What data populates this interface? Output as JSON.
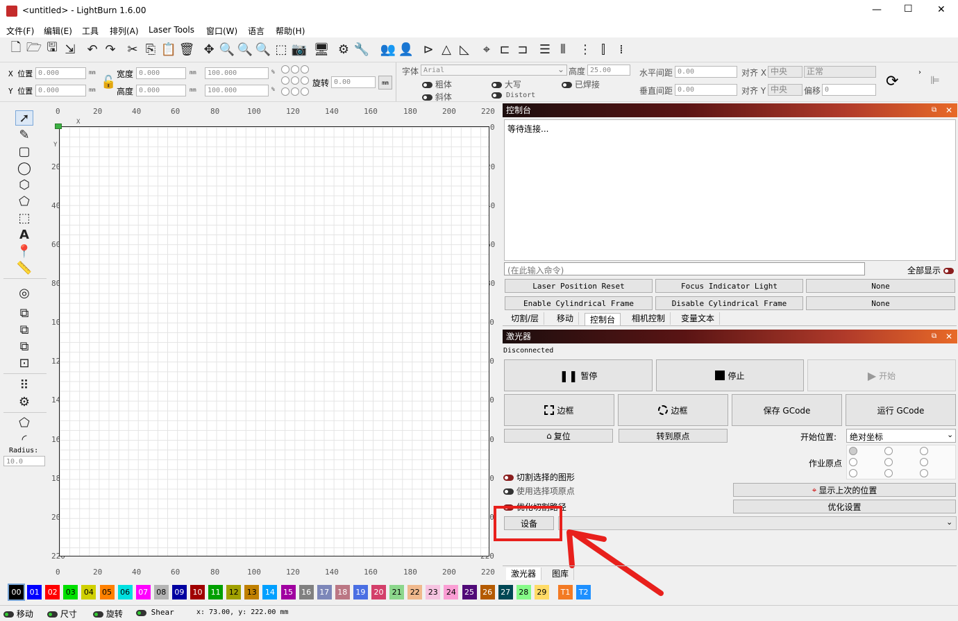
{
  "window": {
    "title": "<untitled>  - LightBurn 1.6.00",
    "min": "—",
    "max": "☐",
    "close": "✕"
  },
  "menu": [
    "文件(F)",
    "编辑(E)",
    "工具",
    "排列(A)",
    "Laser Tools",
    "窗口(W)",
    "语言",
    "帮助(H)"
  ],
  "props": {
    "x_label": "X 位置",
    "y_label": "Y 位置",
    "x_val": "0.000",
    "y_val": "0.000",
    "unit": "mm",
    "w_label": "宽度",
    "h_label": "高度",
    "w_val": "0.000",
    "h_val": "0.000",
    "pw_val": "100.000",
    "ph_val": "100.000",
    "pct": "%",
    "rot_label": "旋转",
    "rot_val": "0.00",
    "mm_btn": "mm",
    "font_label": "字体",
    "font_val": "Arial",
    "bold": "粗体",
    "italic": "斜体",
    "caps": "大写",
    "distort": "Distort",
    "welded": "已焊接",
    "height_label": "高度",
    "height_val": "25.00",
    "hspace_label": "水平间距",
    "vspace_label": "垂直间距",
    "hspace_val": "0.00",
    "vspace_val": "0.00",
    "alignx_label": "对齐 X",
    "aligny_label": "对齐 Y",
    "alignx_val": "中央",
    "aligny_val": "中央",
    "normal_val": "正常",
    "offset_label": "偏移",
    "offset_val": "0"
  },
  "tools": {
    "radius_label": "Radius:",
    "radius_val": "10.0"
  },
  "ruler": {
    "top": [
      "0",
      "20",
      "40",
      "60",
      "80",
      "100",
      "120",
      "140",
      "160",
      "180",
      "200",
      "220"
    ],
    "left": [
      "",
      "20",
      "40",
      "60",
      "80",
      "100",
      "120",
      "140",
      "160",
      "180",
      "200",
      "220"
    ],
    "right": [
      "0",
      "20",
      "40",
      "60",
      "80",
      "100",
      "120",
      "140",
      "160",
      "180",
      "200",
      "220"
    ],
    "x_mark": "X",
    "y_mark": "Y"
  },
  "console": {
    "title": "控制台",
    "output": "等待连接...",
    "placeholder": "(在此输入命令)",
    "show_all": "全部显示",
    "macros": [
      "Laser Position Reset",
      "Focus Indicator Light",
      "None",
      "Enable Cylindrical Frame",
      "Disable Cylindrical Frame",
      "None"
    ],
    "tabs": [
      "切割/层",
      "移动",
      "控制台",
      "相机控制",
      "变量文本"
    ]
  },
  "laser": {
    "title": "激光器",
    "status": "Disconnected",
    "pause": "暂停",
    "stop": "停止",
    "start": "开始",
    "frame1": "边框",
    "frame2": "边框",
    "save_gcode": "保存 GCode",
    "run_gcode": "运行 GCode",
    "home": "复位",
    "goto_origin": "转到原点",
    "start_from_label": "开始位置:",
    "start_from_val": "绝对坐标",
    "job_origin_label": "作业原点",
    "cut_selected": "切割选择的图形",
    "use_sel_origin": "使用选择项原点",
    "optimize_path": "优化切割路径",
    "show_last": "显示上次的位置",
    "opt_settings": "优化设置",
    "devices": "设备",
    "bottom_tabs": [
      "激光器",
      "图库"
    ]
  },
  "palette": [
    {
      "n": "00",
      "c": "#000000",
      "t": "#ffffff"
    },
    {
      "n": "01",
      "c": "#0000ff",
      "t": "#ffffff"
    },
    {
      "n": "02",
      "c": "#ff0000",
      "t": "#ffffff"
    },
    {
      "n": "03",
      "c": "#00e000",
      "t": "#000000"
    },
    {
      "n": "04",
      "c": "#d0d000",
      "t": "#000000"
    },
    {
      "n": "05",
      "c": "#ff8000",
      "t": "#000000"
    },
    {
      "n": "06",
      "c": "#00e0e0",
      "t": "#000000"
    },
    {
      "n": "07",
      "c": "#ff00ff",
      "t": "#ffffff"
    },
    {
      "n": "08",
      "c": "#b4b4b4",
      "t": "#000000"
    },
    {
      "n": "09",
      "c": "#0000a0",
      "t": "#ffffff"
    },
    {
      "n": "10",
      "c": "#a00000",
      "t": "#ffffff"
    },
    {
      "n": "11",
      "c": "#00a000",
      "t": "#ffffff"
    },
    {
      "n": "12",
      "c": "#a0a000",
      "t": "#000000"
    },
    {
      "n": "13",
      "c": "#c08000",
      "t": "#000000"
    },
    {
      "n": "14",
      "c": "#00a0ff",
      "t": "#ffffff"
    },
    {
      "n": "15",
      "c": "#a000a0",
      "t": "#ffffff"
    },
    {
      "n": "16",
      "c": "#808080",
      "t": "#ffffff"
    },
    {
      "n": "17",
      "c": "#7d87b9",
      "t": "#ffffff"
    },
    {
      "n": "18",
      "c": "#bb7784",
      "t": "#ffffff"
    },
    {
      "n": "19",
      "c": "#4a6fe3",
      "t": "#ffffff"
    },
    {
      "n": "20",
      "c": "#d33f6a",
      "t": "#ffffff"
    },
    {
      "n": "21",
      "c": "#8cd78c",
      "t": "#000000"
    },
    {
      "n": "22",
      "c": "#f0b98d",
      "t": "#000000"
    },
    {
      "n": "23",
      "c": "#f6c4e1",
      "t": "#000000"
    },
    {
      "n": "24",
      "c": "#fa9ed4",
      "t": "#000000"
    },
    {
      "n": "25",
      "c": "#500a78",
      "t": "#ffffff"
    },
    {
      "n": "26",
      "c": "#b45a00",
      "t": "#ffffff"
    },
    {
      "n": "27",
      "c": "#004754",
      "t": "#ffffff"
    },
    {
      "n": "28",
      "c": "#86fa88",
      "t": "#000000"
    },
    {
      "n": "29",
      "c": "#ffdb66",
      "t": "#000000"
    },
    {
      "n": "T1",
      "c": "#f37a24",
      "t": "#ffffff"
    },
    {
      "n": "T2",
      "c": "#1e90ff",
      "t": "#ffffff"
    }
  ],
  "statusbar": {
    "move": "移动",
    "size": "尺寸",
    "rotate": "旋转",
    "shear": "Shear",
    "coords": "x: 73.00, y: 222.00 mm"
  },
  "colors": {
    "accent": "#e8201c",
    "grid": "#e4e4e4"
  }
}
